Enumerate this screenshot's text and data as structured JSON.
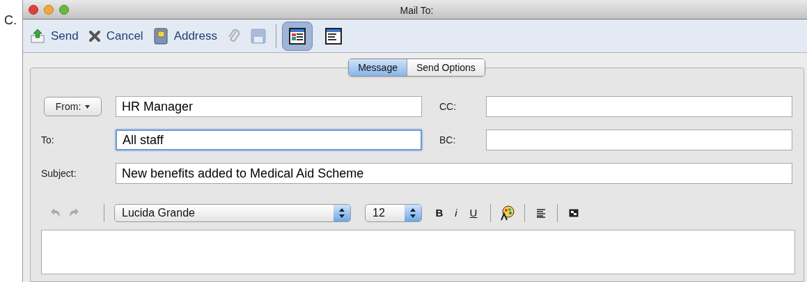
{
  "label_prefix": "C.",
  "window": {
    "title": "Mail To:"
  },
  "actions": [
    {
      "kind": "send",
      "label": "Send",
      "disabled": false
    },
    {
      "kind": "cancel",
      "label": "Cancel",
      "disabled": false
    },
    {
      "kind": "address",
      "label": "Address",
      "disabled": false
    },
    {
      "kind": "attach",
      "disabled": true
    },
    {
      "kind": "save",
      "disabled": true
    }
  ],
  "views": [
    {
      "kind": "full",
      "selected": true
    },
    {
      "kind": "compact",
      "selected": false
    }
  ],
  "tabs": [
    {
      "label": "Message",
      "selected": true
    },
    {
      "label": "Send Options",
      "selected": false
    }
  ],
  "fields": [
    {
      "label": "From:",
      "kind": "dropdown",
      "value": "HR Manager",
      "focused": false
    },
    {
      "label": "CC:",
      "kind": "text",
      "focused": false
    },
    {
      "label": "To:",
      "kind": "text",
      "value": "All staff",
      "focused": true
    },
    {
      "label": "BC:",
      "kind": "text",
      "focused": false
    }
  ],
  "subject": {
    "label": "Subject:",
    "value": "New benefits added to Medical Aid Scheme"
  },
  "format_bar": {
    "undo_disabled": true,
    "redo_disabled": true,
    "font": "Lucida Grande",
    "size": "12",
    "bold": "B",
    "italic": "i",
    "underline": "U"
  }
}
